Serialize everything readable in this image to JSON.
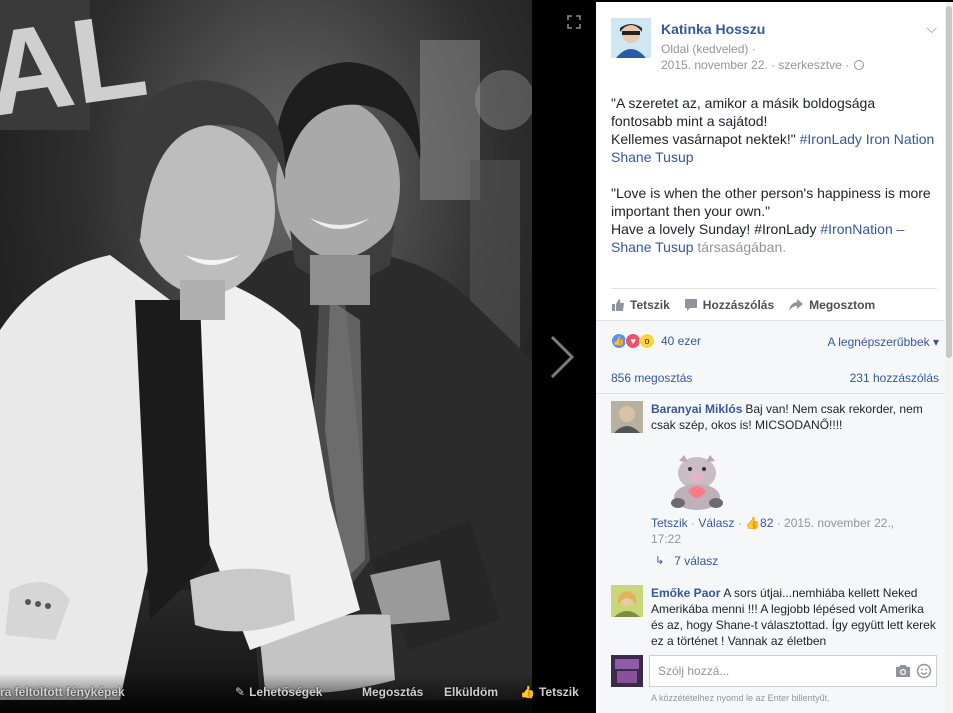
{
  "photo": {
    "footer": {
      "album": "ra feltöltött fényképek",
      "options": "Lehetőségek",
      "share": "Megosztás",
      "send": "Elküldöm",
      "like": "Tetszik"
    }
  },
  "post": {
    "author": "Katinka Hosszu",
    "page_type": "Oldal (kedveled) ·",
    "date": "2015. november 22.",
    "edited": " · szerkesztve · ",
    "hu_quote_line1": "\"A szeretet az, amikor a másik boldogsága fontosabb mint a sajátod!",
    "hu_quote_line2": "Kellemes vasárnapot nektek!\" ",
    "hu_tag": "#IronLady Iron Nation Shane Tusup",
    "en_quote": "\"Love is when the other person's happiness is more important then your own.\"",
    "en_line2": "Have a lovely Sunday! #IronLady ",
    "en_tag": "#IronNation – Shane Tusup",
    "with_suffix": " társaságában."
  },
  "actions": {
    "like": "Tetszik",
    "comment": "Hozzászólás",
    "share": "Megosztom"
  },
  "feedback": {
    "reaction_count": "40 ezer",
    "sort_label": "A legnépszerűbbek",
    "shares": "856 megosztás",
    "comments": "231 hozzászólás"
  },
  "comments": [
    {
      "name": "Baranyai Miklós",
      "text": "Baj van! Nem csak rekorder, nem csak szép, okos is! MICSODANŐ!!!!",
      "like_link": "Tetszik",
      "reply_link": "Válasz",
      "likes": "82",
      "timestamp": "2015. november 22., 17:22",
      "replies": "7 válasz"
    },
    {
      "name": "Emőke Paor",
      "text": "A sors útjai...nemhiába kellett Neked Amerikába menni !!! A legjobb lépésed volt Amerika és az, hogy Shane-t választottad. Így együtt lett kerek ez a történet ! Vannak az életben"
    }
  ],
  "composer": {
    "placeholder": "Szólj hozzá...",
    "hint": "A közzétételhez nyomd le az Enter billentyűt."
  },
  "colors": {
    "link": "#365899",
    "muted": "#90949c",
    "panel_bg": "#f6f7f9"
  }
}
